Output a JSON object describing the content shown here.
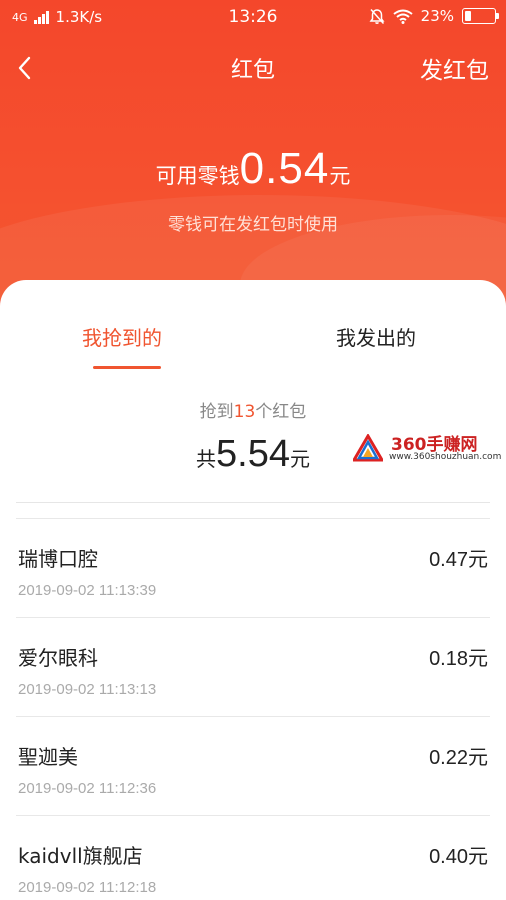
{
  "status_bar": {
    "network": "4G",
    "speed": "1.3K/s",
    "time": "13:26",
    "battery": "23%",
    "battery_level": 0.23
  },
  "nav": {
    "title": "红包",
    "action_label": "发红包"
  },
  "balance": {
    "label": "可用零钱",
    "amount": "0.54",
    "unit": "元",
    "hint": "零钱可在发红包时使用"
  },
  "tabs": [
    {
      "label": "我抢到的",
      "active": true
    },
    {
      "label": "我发出的",
      "active": false
    }
  ],
  "summary": {
    "prefix": "抢到",
    "count": "13",
    "suffix": "个红包",
    "total_prefix": "共",
    "total_amount": "5.54",
    "total_unit": "元"
  },
  "watermark": {
    "name": "360手赚网",
    "url": "www.360shouzhuan.com"
  },
  "records": [
    {
      "name": "瑞博口腔",
      "amount": "0.47元",
      "time": "2019-09-02 11:13:39"
    },
    {
      "name": "爱尔眼科",
      "amount": "0.18元",
      "time": "2019-09-02 11:13:13"
    },
    {
      "name": "聖迦美",
      "amount": "0.22元",
      "time": "2019-09-02 11:12:36"
    },
    {
      "name": "kaidvll旗舰店",
      "amount": "0.40元",
      "time": "2019-09-02 11:12:18"
    }
  ],
  "colors": {
    "primary": "#f24a2c",
    "accent_text": "#f05530"
  }
}
